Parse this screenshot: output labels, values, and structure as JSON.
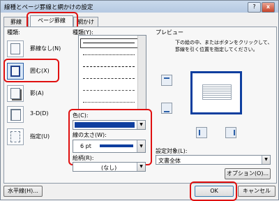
{
  "window": {
    "title": "線種とページ罫線と網かけの設定",
    "help_icon": "?",
    "close_icon": "x"
  },
  "tabs": [
    {
      "label": "罫線"
    },
    {
      "label": "ページ罫線"
    },
    {
      "label": "網かけ"
    }
  ],
  "settings": {
    "section_label": "種類:",
    "items": [
      {
        "label": "罫線なし(N)"
      },
      {
        "label": "囲む(X)"
      },
      {
        "label": "影(A)"
      },
      {
        "label": "3-D(D)"
      },
      {
        "label": "指定(U)"
      }
    ]
  },
  "style": {
    "label": "種類(Y):"
  },
  "color": {
    "label": "色(C):",
    "value_color": "#0f3f9f"
  },
  "width": {
    "label": "線の太さ(W):",
    "value": "6 pt"
  },
  "art": {
    "label": "絵柄(R):",
    "value": "(なし)"
  },
  "preview": {
    "label": "プレビュー",
    "instruction": "下の絵の中、またはボタンをクリックして、罫線を引く位置を指定してください。"
  },
  "apply": {
    "label": "設定対象(L):",
    "value": "文書全体"
  },
  "buttons": {
    "options": "オプション(O)...",
    "horizontal_line": "水平線(H)...",
    "ok": "OK",
    "cancel": "キャンセル"
  }
}
